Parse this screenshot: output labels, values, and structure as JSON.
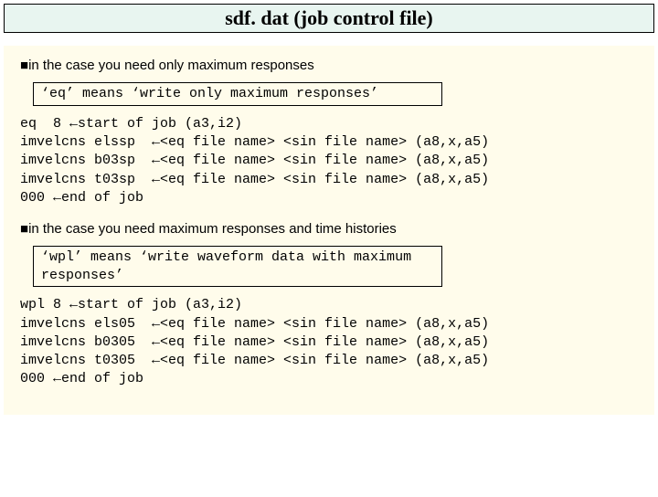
{
  "title": "sdf. dat (job control file)",
  "section1": {
    "heading_prefix": "■",
    "heading": "in the case you need only maximum responses",
    "note": "‘eq’ means ‘write only maximum responses’",
    "code": "eq  8 ←start of job (a3,i2)\nimvelcns elssp  ←<eq file name> <sin file name> (a8,x,a5)\nimvelcns b03sp  ←<eq file name> <sin file name> (a8,x,a5)\nimvelcns t03sp  ←<eq file name> <sin file name> (a8,x,a5)\n000 ←end of job"
  },
  "section2": {
    "heading_prefix": "■",
    "heading": "in the case you need maximum responses and time histories",
    "note": "‘wpl’ means ‘write waveform data with maximum responses’",
    "code": "wpl 8 ←start of job (a3,i2)\nimvelcns els05  ←<eq file name> <sin file name> (a8,x,a5)\nimvelcns b0305  ←<eq file name> <sin file name> (a8,x,a5)\nimvelcns t0305  ←<eq file name> <sin file name> (a8,x,a5)\n000 ←end of job"
  }
}
